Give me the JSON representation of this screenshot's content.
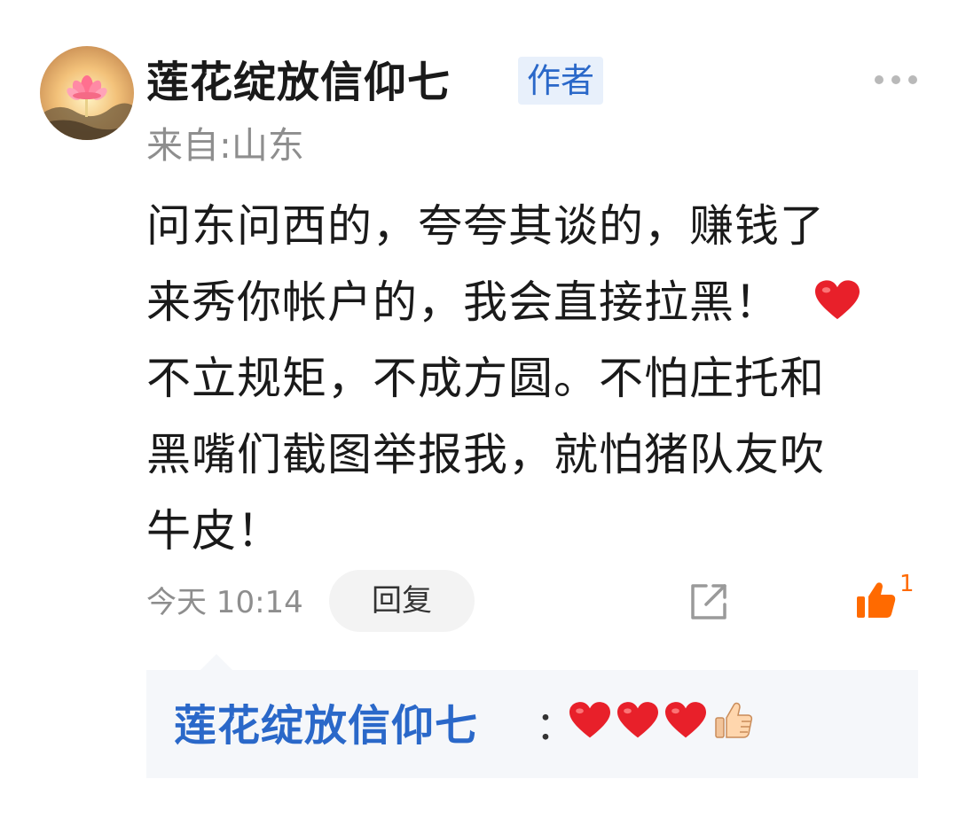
{
  "comment": {
    "username": "莲花绽放信仰七",
    "author_badge": "作者",
    "location": "来自:山东",
    "content_lines": [
      "问东问西的，夸夸其谈的，赚钱了",
      "来秀你帐户的，我会直接拉黑！",
      "不立规矩，不成方圆。不怕庄托和",
      "黑嘴们截图举报我，就怕猪队友吹",
      "牛皮！"
    ],
    "time": "今天 10:14",
    "reply_label": "回复",
    "like_count": "1"
  },
  "reply": {
    "username": "莲花绽放信仰七",
    "colon": "：",
    "emojis": [
      "heart-emoji",
      "heart-emoji",
      "heart-emoji",
      "thumbs-up-emoji"
    ]
  },
  "icons": {
    "avatar": "lotus-avatar",
    "more": "more-dots-icon",
    "share": "share-icon",
    "like": "thumbs-up-icon"
  },
  "colors": {
    "accent_blue": "#2a68c9",
    "like_orange": "#ff6a00",
    "heart_red": "#e8202a",
    "muted_gray": "#8e8e8e"
  }
}
